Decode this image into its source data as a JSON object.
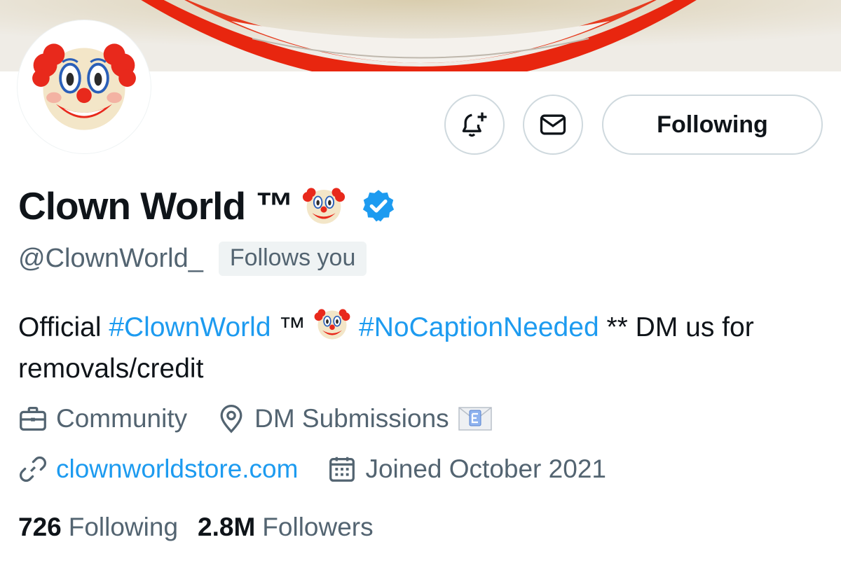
{
  "profile": {
    "display_name": "Clown World ™",
    "handle": "@ClownWorld_",
    "follows_you": "Follows you",
    "verified": true
  },
  "actions": {
    "notify_icon": "bell-plus-icon",
    "message_icon": "envelope-icon",
    "following_label": "Following"
  },
  "bio": {
    "text_start": "Official ",
    "hashtag1": "#ClownWorld",
    "tm": " ™ ",
    "hashtag2": "#NoCaptionNeeded",
    "text_end": " ** DM us for removals/credit"
  },
  "meta": {
    "category": "Community",
    "location": "DM Submissions",
    "website": "clownworldstore.com",
    "joined": "Joined October 2021"
  },
  "stats": {
    "following_count": "726",
    "following_label": "Following",
    "followers_count": "2.8M",
    "followers_label": "Followers"
  },
  "colors": {
    "link_blue": "#1d9bf0",
    "secondary_text": "#536471",
    "primary_text": "#0f1419",
    "border": "#cfd9de"
  }
}
